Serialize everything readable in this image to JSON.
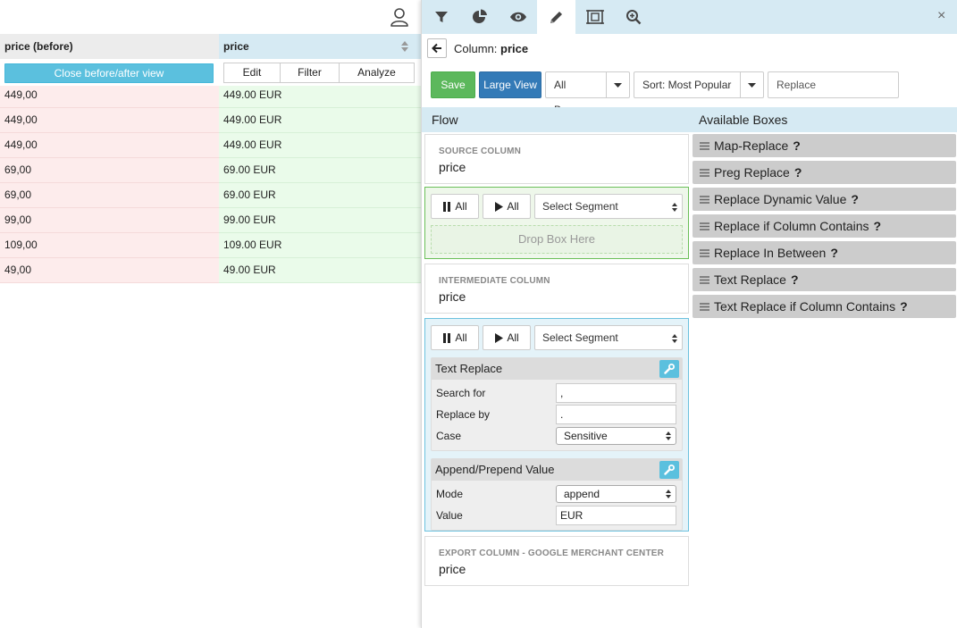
{
  "left": {
    "before_header": "price (before)",
    "after_header": "price",
    "close_button": "Close before/after view",
    "buttons": [
      "Edit",
      "Filter",
      "Analyze"
    ],
    "rows": [
      {
        "before": "449,00",
        "after": "449.00 EUR"
      },
      {
        "before": "449,00",
        "after": "449.00 EUR"
      },
      {
        "before": "449,00",
        "after": "449.00 EUR"
      },
      {
        "before": "69,00",
        "after": "69.00 EUR"
      },
      {
        "before": "69,00",
        "after": "69.00 EUR"
      },
      {
        "before": "99,00",
        "after": "99.00 EUR"
      },
      {
        "before": "109,00",
        "after": "109.00 EUR"
      },
      {
        "before": "49,00",
        "after": "49.00 EUR"
      }
    ]
  },
  "toolbar": {
    "icons": [
      "filter-icon",
      "pie-chart-icon",
      "eye-icon",
      "pencil-icon",
      "crop-frame-icon",
      "zoom-icon"
    ],
    "active": "pencil-icon",
    "close": "×"
  },
  "breadcrumb": {
    "prefix": "Column:",
    "column": "price"
  },
  "actions": {
    "save": "Save",
    "large_view": "Large View",
    "boxes_filter": "All Boxes",
    "sort": "Sort: Most Popular",
    "search_value": "Replace"
  },
  "section": {
    "flow": "Flow",
    "available": "Available Boxes"
  },
  "flow": {
    "source": {
      "label": "SOURCE COLUMN",
      "value": "price"
    },
    "segment1": {
      "pause_all": "All",
      "play_all": "All",
      "select": "Select Segment",
      "drop": "Drop Box Here"
    },
    "intermediate": {
      "label": "INTERMEDIATE COLUMN",
      "value": "price"
    },
    "segment2": {
      "pause_all": "All",
      "play_all": "All",
      "select": "Select Segment",
      "text_replace": {
        "title": "Text Replace",
        "search_label": "Search for",
        "search_value": ",",
        "replace_label": "Replace by",
        "replace_value": ".",
        "case_label": "Case",
        "case_value": "Sensitive"
      },
      "append": {
        "title": "Append/Prepend Value",
        "mode_label": "Mode",
        "mode_value": "append",
        "value_label": "Value",
        "value_value": "EUR"
      }
    },
    "export": {
      "label": "EXPORT COLUMN - GOOGLE MERCHANT CENTER",
      "value": "price"
    }
  },
  "available_boxes": [
    "Map-Replace",
    "Preg Replace",
    "Replace Dynamic Value",
    "Replace if Column Contains",
    "Replace In Between",
    "Text Replace",
    "Text Replace if Column Contains"
  ],
  "help_mark": "?",
  "colors": {
    "header_blue": "#d6eaf3",
    "save_green": "#5cb85c",
    "primary_blue": "#337ab7",
    "info_blue": "#5bc0de",
    "before_bg": "#fdecec",
    "after_bg": "#eafbea"
  }
}
